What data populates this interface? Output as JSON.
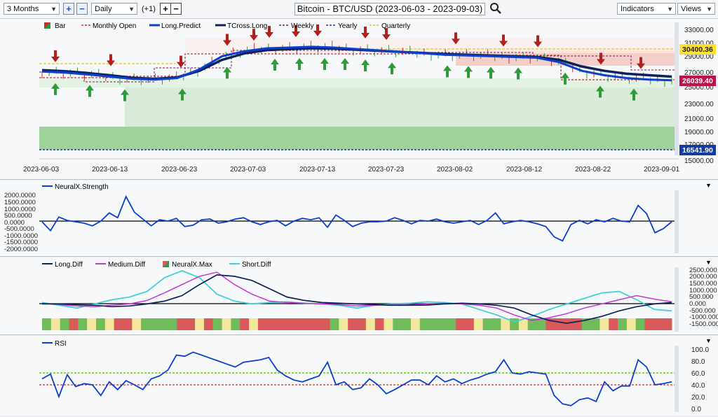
{
  "toolbar": {
    "period": "3 Months",
    "interval": "Daily",
    "step": "(+1)",
    "title": "Bitcoin - BTC/USD (2023-06-03 - 2023-09-03)",
    "indicators": "Indicators",
    "views": "Views"
  },
  "main_panel": {
    "legend": {
      "bar": "Bar",
      "monthly_open": "Monthly Open",
      "long_predict": "Long.Predict",
      "tcross_long": "TCross.Long",
      "weekly": "Weekly",
      "yearly": "Yearly",
      "quarterly": "Quarterly"
    },
    "price_ticks": [
      "33000.00",
      "31000.00",
      "29000.00",
      "27000.00",
      "25000.00",
      "23000.00",
      "21000.00",
      "19000.00",
      "17000.00",
      "15000.00"
    ],
    "price_badges": {
      "upper": "30400.36",
      "current": "26039.40",
      "lower": "16541.90"
    },
    "date_ticks": [
      "2023-06-03",
      "2023-06-13",
      "2023-06-23",
      "2023-07-03",
      "2023-07-13",
      "2023-07-23",
      "2023-08-02",
      "2023-08-12",
      "2023-08-22",
      "2023-09-01"
    ]
  },
  "strength_panel": {
    "title": "NeuralX.Strength",
    "ticks": [
      "2000.0000",
      "1500.0000",
      "1000.0000",
      "500.0000",
      "0.0000",
      "-500.0000",
      "-1000.0000",
      "-1500.0000",
      "-2000.0000"
    ]
  },
  "diff_panel": {
    "legend": {
      "long_diff": "Long.Diff",
      "medium_diff": "Medium.Diff",
      "neuralx_max": "NeuralX.Max",
      "short_diff": "Short.Diff"
    },
    "ticks": [
      "2500.000",
      "2000.000",
      "1500.000",
      "1000.000",
      "500.000",
      "0.000",
      "-500.000",
      "-1000.000",
      "-1500.000"
    ]
  },
  "rsi_panel": {
    "title": "RSI",
    "ticks": [
      "100.0",
      "80.0",
      "60.0",
      "40.0",
      "20.0",
      "0.0"
    ]
  },
  "colors": {
    "up_arrow": "#2f9a3a",
    "down_arrow": "#b0201f",
    "long_predict": "#0a3fcf",
    "tcross": "#0d2259",
    "badge_red": "#c0124a",
    "badge_navy": "#123c9e",
    "badge_yellow": "#ffe033"
  },
  "chart_data": [
    {
      "type": "line",
      "title": "Bitcoin - BTC/USD (2023-06-03 - 2023-09-03)",
      "x_range": [
        "2023-06-03",
        "2023-09-03"
      ],
      "ylim": [
        15000,
        33500
      ],
      "series": [
        {
          "name": "Long.Predict",
          "values": [
            27200,
            27050,
            26800,
            26500,
            26200,
            26100,
            26300,
            27500,
            29300,
            30000,
            30400,
            30500,
            30600,
            30500,
            30300,
            30100,
            29900,
            29700,
            29500,
            29400,
            29300,
            29200,
            29100,
            28500,
            27300,
            26700,
            26300,
            26100,
            26000
          ]
        },
        {
          "name": "TCross.Long",
          "values": [
            27400,
            27250,
            27000,
            26700,
            26350,
            26200,
            26400,
            27300,
            28800,
            29700,
            30150,
            30300,
            30400,
            30350,
            30200,
            30050,
            29900,
            29750,
            29600,
            29500,
            29400,
            29300,
            29200,
            28800,
            27900,
            27300,
            26900,
            26700,
            26500
          ]
        }
      ]
    },
    {
      "type": "line",
      "title": "NeuralX.Strength",
      "ylim": [
        -2000,
        2000
      ],
      "series": [
        {
          "name": "NeuralX.Strength",
          "values": [
            0,
            -650,
            350,
            100,
            0,
            -100,
            -300,
            50,
            650,
            300,
            1850,
            700,
            200,
            -300,
            150,
            50,
            250,
            -350,
            -250,
            150,
            200,
            -100,
            0,
            200,
            300,
            0,
            -200,
            0,
            100,
            -300,
            50,
            250,
            150,
            300,
            -400,
            500,
            100,
            -350,
            -100,
            0,
            0,
            50,
            300,
            100,
            -150,
            100,
            50,
            200,
            0,
            -100,
            0,
            100,
            -200,
            100,
            650,
            -150,
            0,
            100,
            0,
            -150,
            -350,
            -1100,
            -1400,
            -200,
            100,
            -150,
            150,
            0,
            250,
            50,
            0,
            1200,
            600,
            -800,
            -500,
            0
          ]
        }
      ]
    },
    {
      "type": "line",
      "title": "Diff",
      "ylim": [
        -1500,
        2500
      ],
      "series": [
        {
          "name": "Long.Diff",
          "values": [
            0,
            0,
            -50,
            -100,
            -200,
            -150,
            0,
            200,
            600,
            1400,
            2100,
            2000,
            1700,
            1100,
            500,
            250,
            100,
            50,
            0,
            -50,
            -100,
            -100,
            -80,
            0,
            50,
            0,
            -100,
            -300,
            -800,
            -1200,
            -1400,
            -1200,
            -900,
            -500,
            -200,
            0,
            100
          ]
        },
        {
          "name": "Medium.Diff",
          "values": [
            50,
            -50,
            -150,
            -200,
            -100,
            0,
            250,
            800,
            1400,
            2000,
            2300,
            1400,
            700,
            200,
            100,
            50,
            0,
            -50,
            -150,
            -100,
            -50,
            -50,
            0,
            50,
            0,
            -100,
            -300,
            -800,
            -1200,
            -1000,
            -700,
            -300,
            0,
            300,
            600,
            350,
            150
          ]
        },
        {
          "name": "Short.Diff",
          "values": [
            100,
            -100,
            -300,
            0,
            300,
            500,
            900,
            1900,
            2400,
            1900,
            700,
            200,
            0,
            100,
            150,
            50,
            0,
            -100,
            -300,
            -100,
            0,
            50,
            150,
            100,
            0,
            -400,
            -800,
            -1300,
            -900,
            -400,
            0,
            400,
            800,
            900,
            300,
            -400,
            -500
          ]
        }
      ]
    },
    {
      "type": "line",
      "title": "RSI",
      "ylim": [
        0,
        100
      ],
      "series": [
        {
          "name": "RSI",
          "values": [
            50,
            58,
            20,
            57,
            37,
            42,
            40,
            22,
            45,
            32,
            47,
            40,
            32,
            50,
            55,
            65,
            90,
            88,
            95,
            90,
            85,
            80,
            75,
            70,
            78,
            80,
            82,
            86,
            65,
            55,
            48,
            45,
            50,
            55,
            78,
            40,
            45,
            32,
            35,
            50,
            40,
            25,
            32,
            40,
            48,
            48,
            40,
            55,
            45,
            50,
            42,
            48,
            52,
            58,
            62,
            82,
            60,
            58,
            62,
            60,
            58,
            22,
            8,
            5,
            15,
            18,
            12,
            45,
            30,
            38,
            38,
            82,
            70,
            40,
            42,
            45
          ]
        }
      ]
    }
  ]
}
